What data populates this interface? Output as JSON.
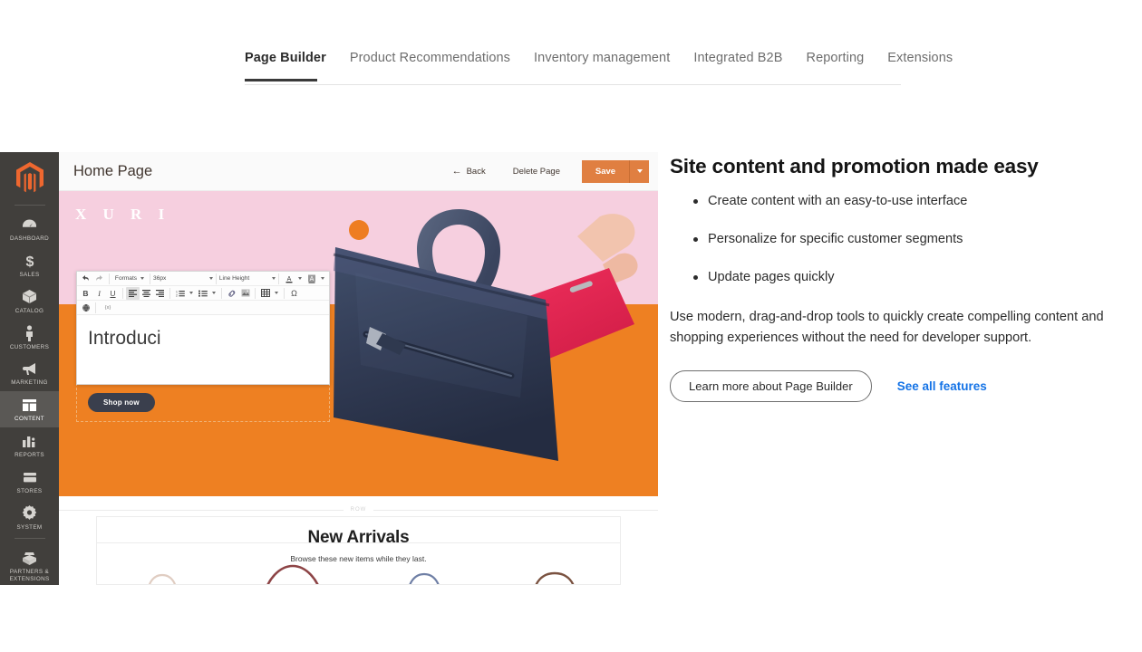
{
  "feature_tabs": [
    {
      "label": "Page Builder",
      "active": true
    },
    {
      "label": "Product Recommendations",
      "active": false
    },
    {
      "label": "Inventory management",
      "active": false
    },
    {
      "label": "Integrated B2B",
      "active": false
    },
    {
      "label": "Reporting",
      "active": false
    },
    {
      "label": "Extensions",
      "active": false
    }
  ],
  "screenshot": {
    "sidebar": {
      "logo": "magento-logo-icon",
      "items": [
        {
          "label": "Dashboard",
          "icon": "dashboard-icon",
          "active": false
        },
        {
          "label": "Sales",
          "icon": "dollar-icon",
          "active": false
        },
        {
          "label": "Catalog",
          "icon": "box-icon",
          "active": false
        },
        {
          "label": "Customers",
          "icon": "person-icon",
          "active": false
        },
        {
          "label": "Marketing",
          "icon": "megaphone-icon",
          "active": false
        },
        {
          "label": "Content",
          "icon": "layout-icon",
          "active": true
        },
        {
          "label": "Reports",
          "icon": "bar-chart-icon",
          "active": false
        },
        {
          "label": "Stores",
          "icon": "store-icon",
          "active": false
        },
        {
          "label": "System",
          "icon": "gear-icon",
          "active": false
        },
        {
          "label": "Partners & Extensions",
          "icon": "open-box-icon",
          "active": false
        }
      ]
    },
    "header": {
      "title": "Home Page",
      "back_label": "Back",
      "back_icon": "arrow-left-icon",
      "delete_label": "Delete Page",
      "save_label": "Save",
      "save_caret_icon": "chevron-down-icon"
    },
    "stage": {
      "brand": "X U R I",
      "editor": {
        "toolbar_row1": [
          {
            "name": "undo-icon",
            "type": "icon"
          },
          {
            "name": "redo-icon",
            "type": "icon"
          },
          {
            "name": "formats-select",
            "type": "select",
            "value": "Formats"
          },
          {
            "name": "font-size-select",
            "type": "select",
            "value": "36px"
          },
          {
            "name": "line-height-select",
            "type": "select",
            "value": "Line Height"
          },
          {
            "name": "text-color-icon",
            "type": "icon"
          },
          {
            "name": "background-color-icon",
            "type": "icon"
          }
        ],
        "toolbar_row2": [
          {
            "name": "bold-icon",
            "label": "B"
          },
          {
            "name": "italic-icon",
            "label": "I"
          },
          {
            "name": "underline-icon",
            "label": "U"
          },
          {
            "name": "align-left-icon",
            "label": "",
            "active": true
          },
          {
            "name": "align-center-icon",
            "label": ""
          },
          {
            "name": "align-right-icon",
            "label": ""
          },
          {
            "name": "ordered-list-icon",
            "label": ""
          },
          {
            "name": "unordered-list-icon",
            "label": ""
          },
          {
            "name": "insert-link-icon",
            "label": ""
          },
          {
            "name": "insert-image-icon",
            "label": ""
          },
          {
            "name": "insert-table-icon",
            "label": ""
          },
          {
            "name": "special-character-icon",
            "label": "Ω"
          }
        ],
        "toolbar_row3": [
          {
            "name": "insert-widget-icon",
            "label": ""
          },
          {
            "name": "insert-variable-icon",
            "label": "{x}"
          }
        ],
        "content": "Introduci"
      },
      "shop_now_label": "Shop now",
      "row_divider_label": "ROW",
      "arrivals": {
        "heading": "New Arrivals",
        "subheading": "Browse these new items while they last."
      },
      "products": [
        {
          "name": "product-bag-cream",
          "color": "#e8d6cb"
        },
        {
          "name": "product-bag-maroon",
          "color": "#8d4446"
        },
        {
          "name": "product-bag-blue",
          "color": "#6f7fa5"
        },
        {
          "name": "product-bag-orange",
          "color": "#e98a4e"
        }
      ]
    }
  },
  "copy": {
    "heading": "Site content and promotion made easy",
    "bullets": [
      "Create content with an easy-to-use interface",
      "Personalize for specific customer segments",
      "Update pages quickly"
    ],
    "paragraph": "Use modern, drag-and-drop tools to quickly create compelling content and shopping experiences without the need for developer support.",
    "primary_cta": "Learn more about Page Builder",
    "secondary_cta": "See all features"
  },
  "colors": {
    "accent_orange": "#e07f41",
    "link_blue": "#1473e6",
    "rail_dark": "#413f3c",
    "hero_pink": "#f6cfdf",
    "hero_orange": "#ee8022"
  }
}
